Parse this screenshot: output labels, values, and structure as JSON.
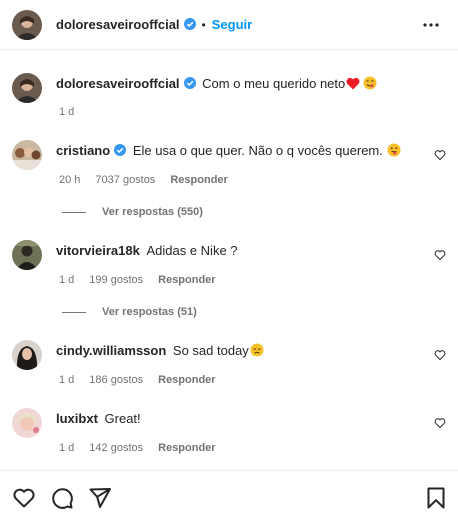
{
  "header": {
    "username": "doloresaveirooffcial",
    "dot": "•",
    "follow_label": "Seguir",
    "more_icon": "more-horizontal-icon"
  },
  "caption": {
    "username": "doloresaveirooffcial",
    "text": "Com o meu querido neto",
    "time": "1 d"
  },
  "comments": [
    {
      "username": "cristiano",
      "verified": true,
      "text": "Ele usa o que quer. Não o q vocês querem.",
      "time": "20 h",
      "likes": "7037 gostos",
      "reply_label": "Responder",
      "view_replies": "Ver respostas (550)"
    },
    {
      "username": "vitorvieira18k",
      "verified": false,
      "text": "Adidas e Nike ?",
      "time": "1 d",
      "likes": "199 gostos",
      "reply_label": "Responder",
      "view_replies": "Ver respostas (51)"
    },
    {
      "username": "cindy.williamsson",
      "verified": false,
      "text": "So sad today",
      "time": "1 d",
      "likes": "186 gostos",
      "reply_label": "Responder"
    },
    {
      "username": "luxibxt",
      "verified": false,
      "text": "Great!",
      "time": "1 d",
      "likes": "142 gostos",
      "reply_label": "Responder"
    }
  ],
  "colors": {
    "link_blue": "#0095f6",
    "verified_blue": "#3897f0",
    "secondary_text": "#737373",
    "heart_red": "#ed1c24"
  }
}
